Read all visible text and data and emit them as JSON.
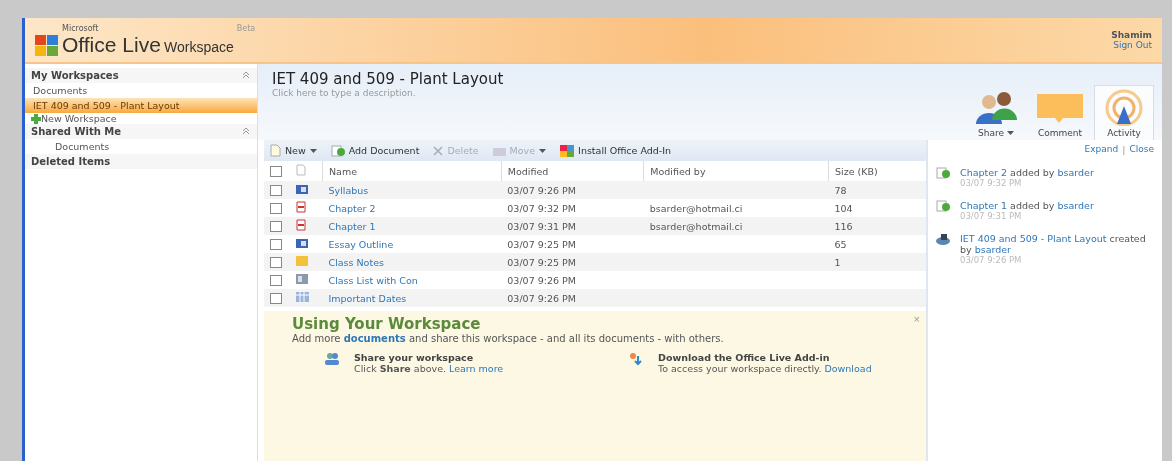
{
  "header": {
    "brand_small": "Microsoft",
    "brand": "Office Live",
    "brand_suffix": "Workspace",
    "beta": "Beta",
    "user": "Shamim",
    "sign_out": "Sign Out"
  },
  "sidebar": {
    "sections": [
      {
        "title": "My Workspaces",
        "collapsible": true,
        "items": [
          {
            "label": "Documents",
            "selected": false,
            "kind": "link"
          },
          {
            "label": "IET 409 and 509 - Plant Layout",
            "selected": true,
            "kind": "link"
          },
          {
            "label": "New Workspace",
            "selected": false,
            "kind": "add"
          }
        ]
      },
      {
        "title": "Shared With Me",
        "collapsible": true,
        "items": [
          {
            "label": "Documents",
            "selected": false,
            "kind": "sub"
          }
        ]
      },
      {
        "title": "Deleted Items",
        "collapsible": false
      }
    ]
  },
  "workspace": {
    "title": "IET 409 and 509 - Plant Layout",
    "description_placeholder": "Click here to type a description."
  },
  "actions": [
    {
      "label": "Share",
      "kind": "share",
      "dropdown": true,
      "selected": false
    },
    {
      "label": "Comment",
      "kind": "comment",
      "dropdown": false,
      "selected": false
    },
    {
      "label": "Activity",
      "kind": "activity",
      "dropdown": false,
      "selected": true
    }
  ],
  "toolbar": [
    {
      "label": "New",
      "kind": "new",
      "dropdown": true,
      "disabled": false
    },
    {
      "label": "Add Document",
      "kind": "add",
      "dropdown": false,
      "disabled": false
    },
    {
      "label": "Delete",
      "kind": "delete",
      "dropdown": false,
      "disabled": true
    },
    {
      "label": "Move",
      "kind": "move",
      "dropdown": true,
      "disabled": true
    },
    {
      "label": "Install Office Add-In",
      "kind": "install",
      "dropdown": false,
      "disabled": false
    }
  ],
  "table": {
    "all_checked": false,
    "columns": [
      "Name",
      "Modified",
      "Modified by",
      "Size (KB)"
    ],
    "rows": [
      {
        "kind": "doc",
        "checked": false,
        "name": "Syllabus",
        "modified": "03/07 9:26 PM",
        "modified_by": "",
        "size": "78"
      },
      {
        "kind": "pdf",
        "checked": false,
        "name": "Chapter 2",
        "modified": "03/07 9:32 PM",
        "modified_by": "bsarder@hotmail.ci",
        "size": "104"
      },
      {
        "kind": "pdf",
        "checked": false,
        "name": "Chapter 1",
        "modified": "03/07 9:31 PM",
        "modified_by": "bsarder@hotmail.ci",
        "size": "116"
      },
      {
        "kind": "doc",
        "checked": false,
        "name": "Essay Outline",
        "modified": "03/07 9:25 PM",
        "modified_by": "",
        "size": "65"
      },
      {
        "kind": "note",
        "checked": false,
        "name": "Class Notes",
        "modified": "03/07 9:25 PM",
        "modified_by": "",
        "size": "1"
      },
      {
        "kind": "list",
        "checked": false,
        "name": "Class List with Con",
        "modified": "03/07 9:26 PM",
        "modified_by": "",
        "size": ""
      },
      {
        "kind": "calendar",
        "checked": false,
        "name": "Important Dates",
        "modified": "03/07 9:26 PM",
        "modified_by": "",
        "size": ""
      }
    ]
  },
  "tips": {
    "close": "×",
    "title": "Using Your Workspace",
    "intro_before": "Add more ",
    "intro_link": "documents",
    "intro_after": " and share this workspace - and all its documents - with others.",
    "cards": [
      {
        "kind": "share",
        "title": "Share your workspace",
        "text": "Click **Share** above.",
        "link": "Learn more"
      },
      {
        "kind": "download",
        "title": "Download the Office Live Add-in",
        "text": "To access your workspace directly.",
        "link": "Download"
      }
    ]
  },
  "activity": {
    "expand": "Expand",
    "separator": "|",
    "close": "Close",
    "items": [
      {
        "kind": "added",
        "subject": "Chapter 2",
        "verb": " added by ",
        "user": "bsarder",
        "time": "03/07 9:32 PM"
      },
      {
        "kind": "added",
        "subject": "Chapter 1",
        "verb": " added by ",
        "user": "bsarder",
        "time": "03/07 9:31 PM"
      },
      {
        "kind": "created",
        "subject": "IET 409 and 509 - Plant Layout",
        "verb": " created by ",
        "user": "bsarder",
        "time": "03/07 9:26 PM"
      }
    ]
  }
}
